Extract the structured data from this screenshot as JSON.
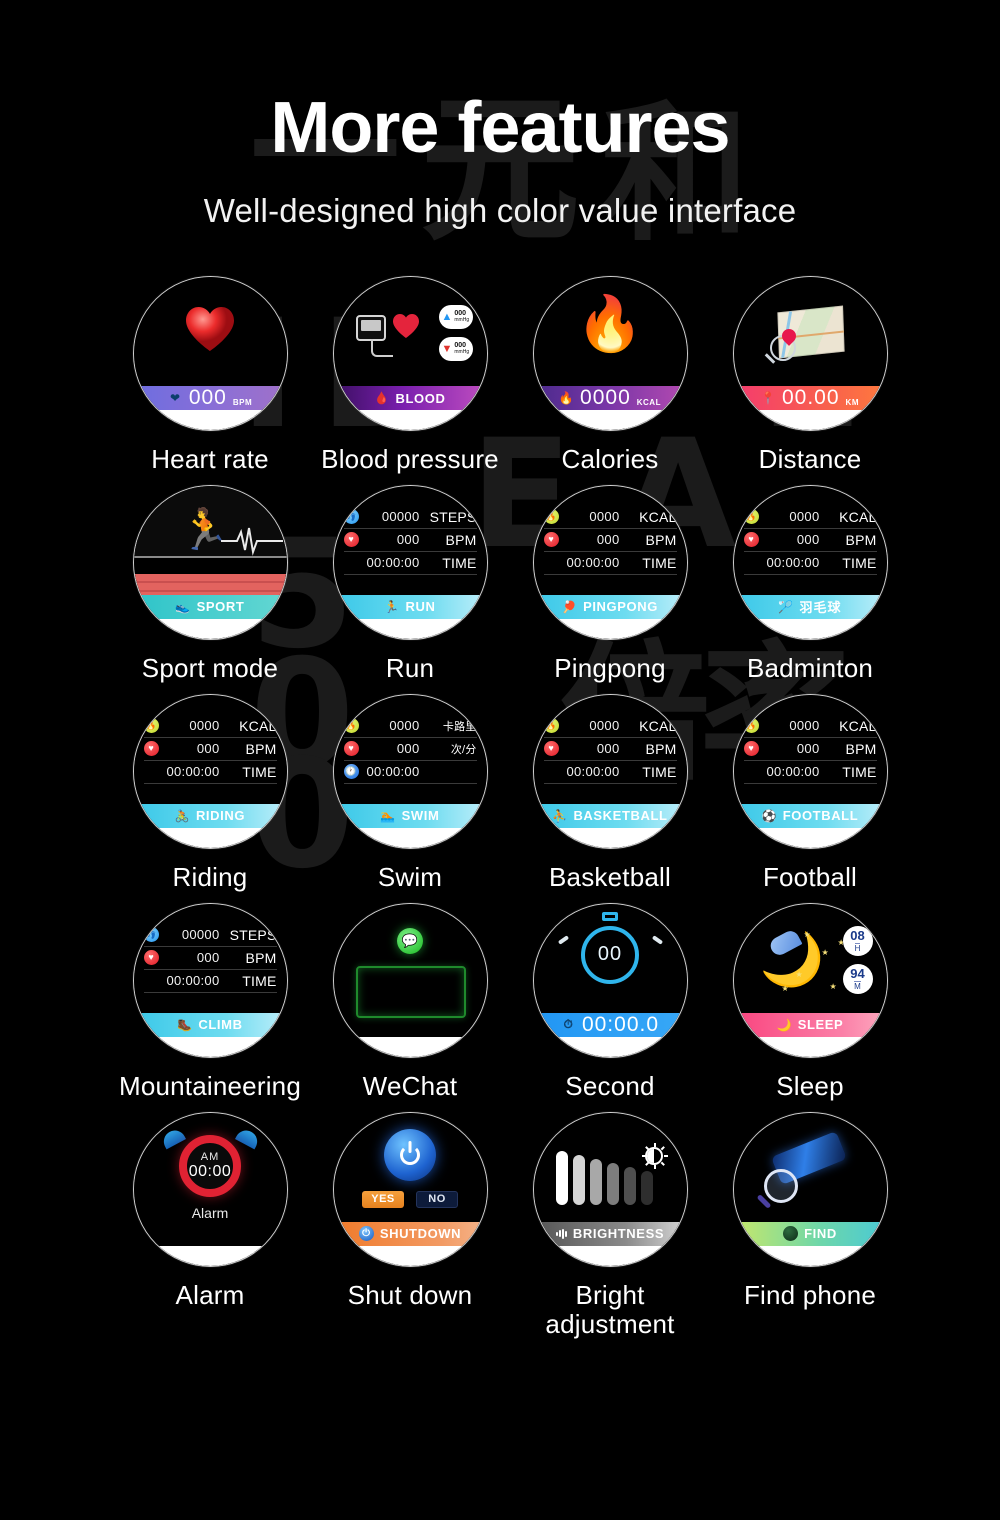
{
  "header": {
    "title": "More features",
    "subtitle": "Well-designed high color value interface"
  },
  "watermark": [
    "一元 和",
    "IDEAL",
    "5000",
    "倍率"
  ],
  "grid": {
    "items": [
      {
        "caption": "Heart rate",
        "face": "heart",
        "bar": {
          "value": "000",
          "unit": "BPM",
          "style": "bar-purple",
          "icon": "heart-badge-icon"
        }
      },
      {
        "caption": "Blood pressure",
        "face": "blood",
        "bar": {
          "label": "BLOOD",
          "style": "bar-blood",
          "icon": "blood-drop-icon"
        },
        "badges": [
          {
            "arrow": "▲",
            "arrow_color": "#2196f3",
            "value": "000",
            "unit": "mmHg"
          },
          {
            "arrow": "▼",
            "arrow_color": "#e0342e",
            "value": "000",
            "unit": "mmHg"
          }
        ]
      },
      {
        "caption": "Calories",
        "face": "calories",
        "bar": {
          "value": "0000",
          "unit": "KCAL",
          "style": "bar-cal",
          "icon": "flame-icon"
        }
      },
      {
        "caption": "Distance",
        "face": "distance",
        "bar": {
          "value": "00.00",
          "unit": "KM",
          "style": "bar-dist",
          "icon": "pin-person-icon"
        }
      },
      {
        "caption": "Sport mode",
        "face": "sport",
        "bar": {
          "label": "SPORT",
          "style": "bar-teal",
          "icon": "running-shoe-icon"
        }
      },
      {
        "caption": "Run",
        "face": "stats",
        "rows": [
          {
            "icon": "steps-icon",
            "value": "00000",
            "label": "STEPS"
          },
          {
            "icon": "heart-icon",
            "value": "000",
            "label": "BPM"
          },
          {
            "icon": "none",
            "value": "00:00:00",
            "label": "TIME"
          }
        ],
        "bar": {
          "label": "RUN",
          "style": "bar-cyan",
          "icon": "runner-icon"
        }
      },
      {
        "caption": "Pingpong",
        "face": "stats",
        "rows": [
          {
            "icon": "kcal-icon",
            "value": "0000",
            "label": "KCAL"
          },
          {
            "icon": "heart-icon",
            "value": "000",
            "label": "BPM"
          },
          {
            "icon": "none",
            "value": "00:00:00",
            "label": "TIME"
          }
        ],
        "bar": {
          "label": "PINGPONG",
          "style": "bar-cyan",
          "icon": "pingpong-player-icon"
        }
      },
      {
        "caption": "Badminton",
        "face": "stats",
        "rows": [
          {
            "icon": "kcal-icon",
            "value": "0000",
            "label": "KCAL"
          },
          {
            "icon": "heart-icon",
            "value": "000",
            "label": "BPM"
          },
          {
            "icon": "none",
            "value": "00:00:00",
            "label": "TIME"
          }
        ],
        "bar": {
          "label": "羽毛球",
          "style": "bar-cyan",
          "icon": "badminton-player-icon",
          "cn": true
        }
      },
      {
        "caption": "Riding",
        "face": "stats",
        "rows": [
          {
            "icon": "kcal-icon",
            "value": "0000",
            "label": "KCAL"
          },
          {
            "icon": "heart-icon",
            "value": "000",
            "label": "BPM"
          },
          {
            "icon": "none",
            "value": "00:00:00",
            "label": "TIME"
          }
        ],
        "bar": {
          "label": "RIDING",
          "style": "bar-cyan",
          "icon": "cyclist-icon"
        }
      },
      {
        "caption": "Swim",
        "face": "stats",
        "rows": [
          {
            "icon": "kcal-icon",
            "value": "0000",
            "label": "卡路里",
            "cn": true
          },
          {
            "icon": "heart-icon",
            "value": "000",
            "label": "次/分",
            "cn": true
          },
          {
            "icon": "clock-icon",
            "value": "00:00:00",
            "label": ""
          }
        ],
        "bar": {
          "label": "SWIM",
          "style": "bar-cyan",
          "icon": "swimmer-icon"
        }
      },
      {
        "caption": "Basketball",
        "face": "stats",
        "rows": [
          {
            "icon": "kcal-icon",
            "value": "0000",
            "label": "KCAL"
          },
          {
            "icon": "heart-icon",
            "value": "000",
            "label": "BPM"
          },
          {
            "icon": "none",
            "value": "00:00:00",
            "label": "TIME"
          }
        ],
        "bar": {
          "label": "BASKETBALL",
          "style": "bar-cyan",
          "icon": "basketball-player-icon"
        }
      },
      {
        "caption": "Football",
        "face": "stats",
        "rows": [
          {
            "icon": "kcal-icon",
            "value": "0000",
            "label": "KCAL"
          },
          {
            "icon": "heart-icon",
            "value": "000",
            "label": "BPM"
          },
          {
            "icon": "none",
            "value": "00:00:00",
            "label": "TIME"
          }
        ],
        "bar": {
          "label": "FOOTBALL",
          "style": "bar-cyan",
          "icon": "footballer-icon"
        }
      },
      {
        "caption": "Mountaineering",
        "face": "stats",
        "rows": [
          {
            "icon": "steps-icon",
            "value": "00000",
            "label": "STEPS"
          },
          {
            "icon": "heart-icon",
            "value": "000",
            "label": "BPM"
          },
          {
            "icon": "none",
            "value": "00:00:00",
            "label": "TIME"
          }
        ],
        "bar": {
          "label": "CLIMB",
          "style": "bar-cyan",
          "icon": "climber-icon"
        }
      },
      {
        "caption": "WeChat",
        "face": "wechat"
      },
      {
        "caption": "Second",
        "face": "second",
        "dial": "00",
        "bar": {
          "value": "00:00.0",
          "style": "bar-blue",
          "icon": "stopwatch-icon"
        }
      },
      {
        "caption": "Sleep",
        "face": "sleep",
        "badges": [
          {
            "value": "08",
            "unit": "H"
          },
          {
            "value": "94",
            "unit": "M"
          }
        ],
        "bar": {
          "label": "SLEEP",
          "style": "bar-pink",
          "icon": "moon-icon"
        }
      },
      {
        "caption": "Alarm",
        "face": "alarm",
        "meridiem": "AM",
        "time": "00:00",
        "label": "Alarm"
      },
      {
        "caption": "Shut down",
        "face": "shutdown",
        "buttons": [
          {
            "label": "YES",
            "style": "sd-yes"
          },
          {
            "label": "NO",
            "style": "sd-no"
          }
        ],
        "bar": {
          "label": "SHUTDOWN",
          "style": "bar-orange",
          "icon": "power-icon"
        }
      },
      {
        "caption": "Bright\nadjustment",
        "face": "brightness",
        "bar": {
          "label": "BRIGHTNESS",
          "style": "bar-gray",
          "icon": "bars-icon"
        }
      },
      {
        "caption": "Find phone",
        "face": "findphone",
        "bar": {
          "label": "FIND",
          "style": "bar-green",
          "icon": "find-dot-icon"
        }
      }
    ]
  },
  "colors": {
    "background": "#000000",
    "text": "#ffffff",
    "accent_cyan": "#3bc8e8",
    "accent_pink": "#f9457f",
    "accent_orange": "#f07a2a"
  }
}
